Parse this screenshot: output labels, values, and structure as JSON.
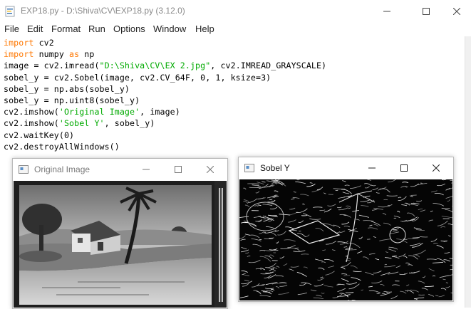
{
  "idle": {
    "title": "EXP18.py - D:\\Shiva\\CV\\EXP18.py (3.12.0)",
    "menu": [
      "File",
      "Edit",
      "Format",
      "Run",
      "Options",
      "Window",
      "Help"
    ],
    "code": [
      [
        {
          "t": "import",
          "c": "kw"
        },
        {
          "t": " cv2",
          "c": ""
        }
      ],
      [
        {
          "t": "import",
          "c": "kw"
        },
        {
          "t": " numpy ",
          "c": ""
        },
        {
          "t": "as",
          "c": "kw"
        },
        {
          "t": " np",
          "c": ""
        }
      ],
      [
        {
          "t": "image = cv2.imread(",
          "c": ""
        },
        {
          "t": "\"D:\\Shiva\\CV\\EX 2.jpg\"",
          "c": "str"
        },
        {
          "t": ", cv2.IMREAD_GRAYSCALE)",
          "c": ""
        }
      ],
      [
        {
          "t": "sobel_y = cv2.Sobel(image, cv2.CV_64F, 0, 1, ksize=3)",
          "c": ""
        }
      ],
      [
        {
          "t": "sobel_y = np.abs(sobel_y)",
          "c": ""
        }
      ],
      [
        {
          "t": "sobel_y = np.uint8(sobel_y)",
          "c": ""
        }
      ],
      [
        {
          "t": "cv2.imshow(",
          "c": ""
        },
        {
          "t": "'Original Image'",
          "c": "str"
        },
        {
          "t": ", image)",
          "c": ""
        }
      ],
      [
        {
          "t": "cv2.imshow(",
          "c": ""
        },
        {
          "t": "'Sobel Y'",
          "c": "str"
        },
        {
          "t": ", sobel_y)",
          "c": ""
        }
      ],
      [
        {
          "t": "cv2.waitKey(0)",
          "c": ""
        }
      ],
      [
        {
          "t": "cv2.destroyAllWindows()",
          "c": ""
        }
      ]
    ]
  },
  "original_window": {
    "title": "Original Image"
  },
  "sobel_window": {
    "title": "Sobel Y"
  },
  "colors": {
    "keyword": "#ff7700",
    "string": "#00aa00",
    "inactive_title": "#8a8a8a"
  }
}
